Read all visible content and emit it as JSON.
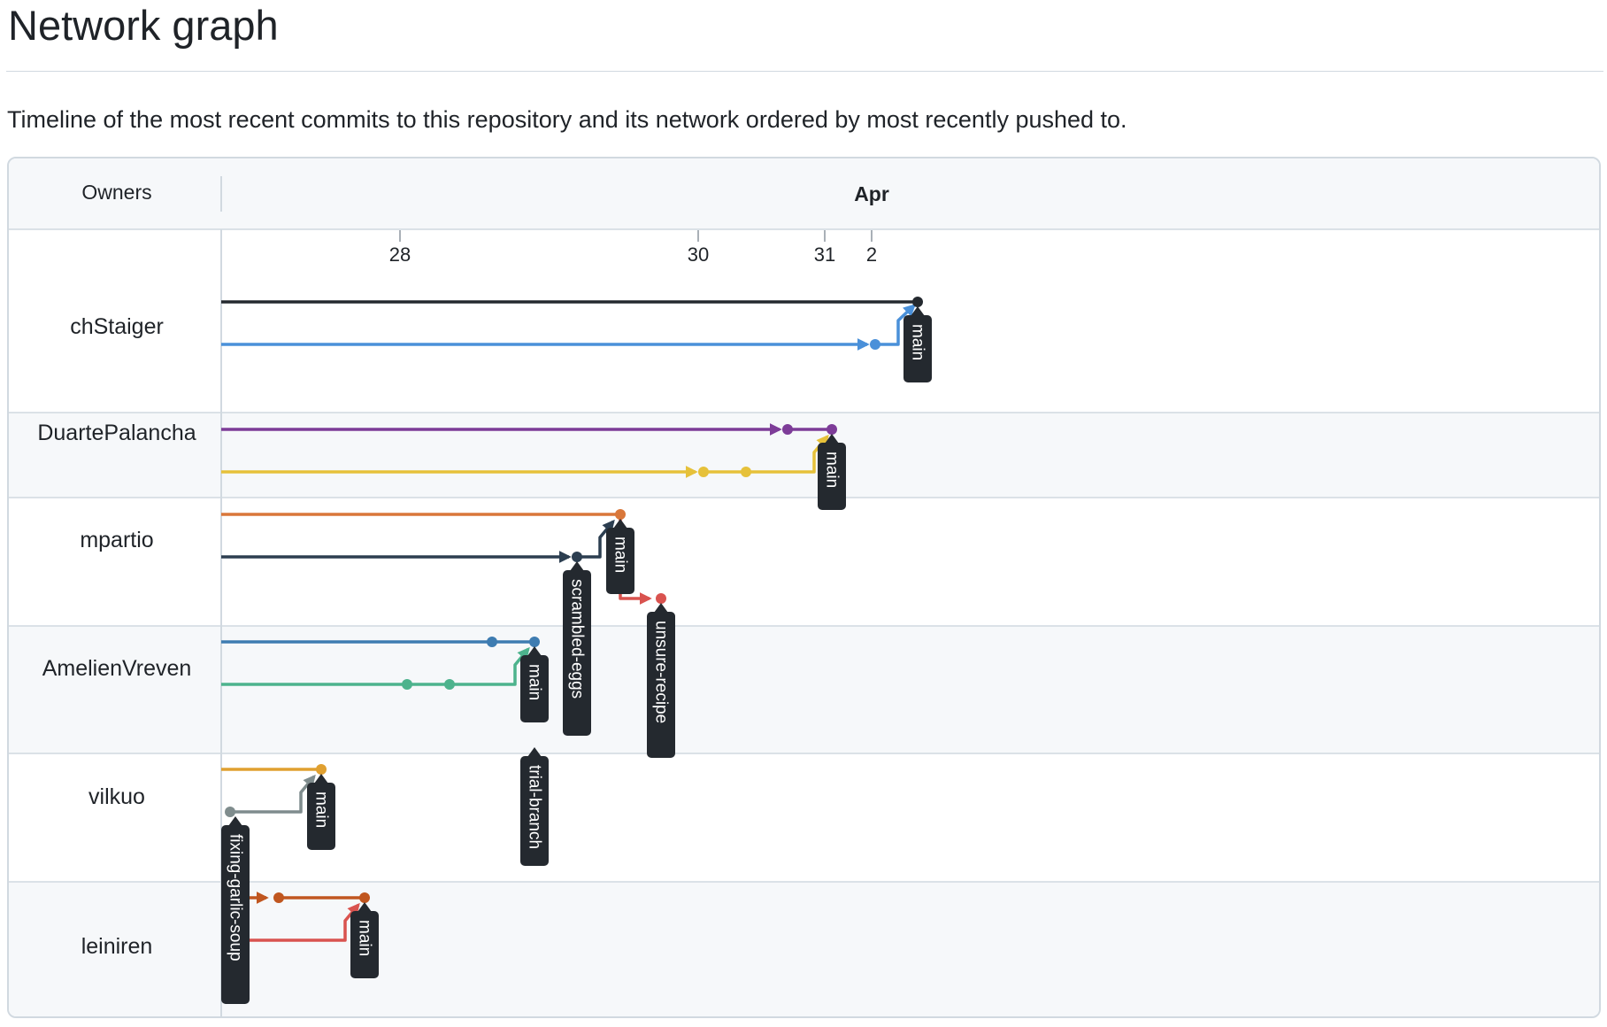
{
  "page": {
    "title": "Network graph",
    "description": "Timeline of the most recent commits to this repository and its network ordered by most recently pushed to."
  },
  "graph": {
    "owners_header": "Owners",
    "month": "Apr",
    "dates": [
      "28",
      "30",
      "31",
      "2"
    ],
    "owners": [
      "chStaiger",
      "DuartePalancha",
      "mpartio",
      "AmelienVreven",
      "vilkuo",
      "leiniren"
    ],
    "colors": {
      "black": "#24292f",
      "blue": "#4a90d9",
      "purple": "#7d3c98",
      "yellow": "#e6c13a",
      "orange": "#d9773a",
      "navy": "#2c3e50",
      "red": "#d9534f",
      "steel": "#3e7cb1",
      "teal": "#4db38d",
      "amber": "#e0a030",
      "gray": "#7f8c8d",
      "rust": "#c0561f",
      "tag_bg": "#24292f"
    },
    "branch_tags": [
      "main",
      "main",
      "main",
      "scrambled-eggs",
      "unsure-recipe",
      "main",
      "trial-branch",
      "main",
      "fixing-garlic-soup",
      "main"
    ]
  }
}
